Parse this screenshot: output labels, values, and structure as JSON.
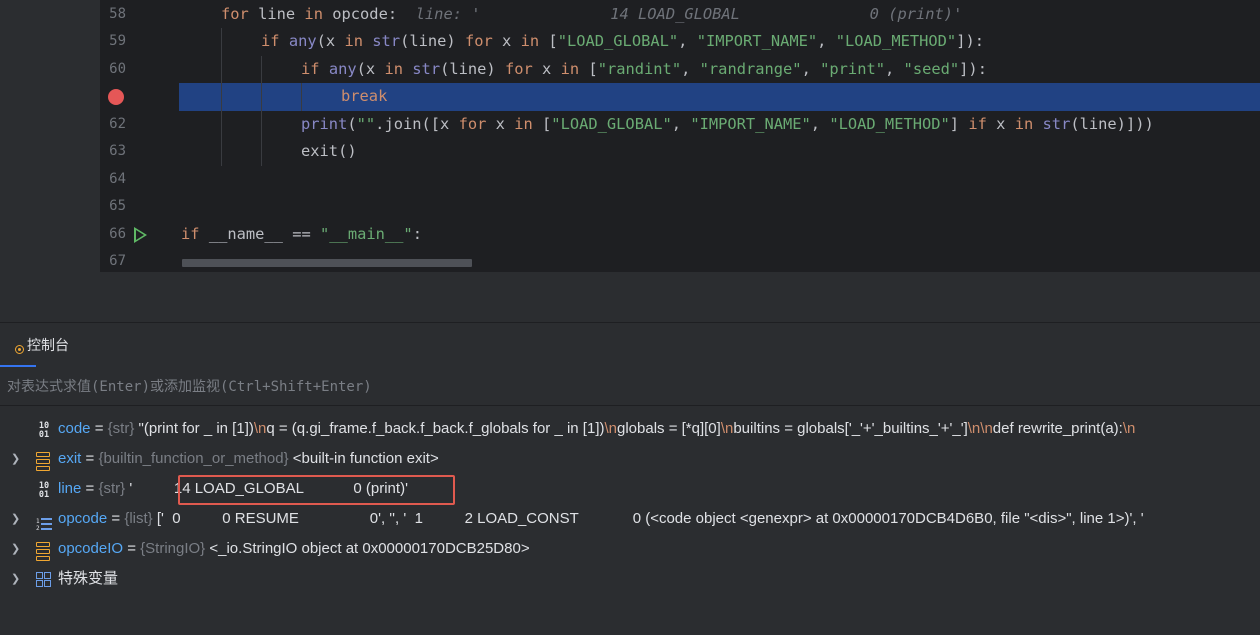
{
  "editor": {
    "lines": [
      {
        "no": "58",
        "indent": 1,
        "tokens": [
          [
            "kw",
            "for"
          ],
          [
            "p",
            " line "
          ],
          [
            "kw",
            "in"
          ],
          [
            "p",
            " opcode:"
          ]
        ],
        "hint": "line: '              14 LOAD_GLOBAL              0 (print)'"
      },
      {
        "no": "59",
        "indent": 2,
        "tokens": [
          [
            "kw",
            "if"
          ],
          [
            "p",
            " "
          ],
          [
            "bi",
            "any"
          ],
          [
            "p",
            "(x "
          ],
          [
            "kw",
            "in"
          ],
          [
            "p",
            " "
          ],
          [
            "bi",
            "str"
          ],
          [
            "p",
            "(line) "
          ],
          [
            "kw",
            "for"
          ],
          [
            "p",
            " x "
          ],
          [
            "kw",
            "in"
          ],
          [
            "p",
            " ["
          ],
          [
            "st",
            "\"LOAD_GLOBAL\""
          ],
          [
            "p",
            ", "
          ],
          [
            "st",
            "\"IMPORT_NAME\""
          ],
          [
            "p",
            ", "
          ],
          [
            "st",
            "\"LOAD_METHOD\""
          ],
          [
            "p",
            "]):"
          ]
        ]
      },
      {
        "no": "60",
        "indent": 3,
        "tokens": [
          [
            "kw",
            "if"
          ],
          [
            "p",
            " "
          ],
          [
            "bi",
            "any"
          ],
          [
            "p",
            "(x "
          ],
          [
            "kw",
            "in"
          ],
          [
            "p",
            " "
          ],
          [
            "bi",
            "str"
          ],
          [
            "p",
            "(line) "
          ],
          [
            "kw",
            "for"
          ],
          [
            "p",
            " x "
          ],
          [
            "kw",
            "in"
          ],
          [
            "p",
            " ["
          ],
          [
            "st",
            "\"randint\""
          ],
          [
            "p",
            ", "
          ],
          [
            "st",
            "\"randrange\""
          ],
          [
            "p",
            ", "
          ],
          [
            "st",
            "\"print\""
          ],
          [
            "p",
            ", "
          ],
          [
            "st",
            "\"seed\""
          ],
          [
            "p",
            "]):"
          ]
        ]
      },
      {
        "no": "",
        "indent": 4,
        "breakpoint": true,
        "highlight": true,
        "tokens": [
          [
            "kw",
            "break"
          ]
        ]
      },
      {
        "no": "62",
        "indent": 3,
        "tokens": [
          [
            "bi",
            "print"
          ],
          [
            "p",
            "("
          ],
          [
            "st",
            "\"\""
          ],
          [
            "p",
            ".join([x "
          ],
          [
            "kw",
            "for"
          ],
          [
            "p",
            " x "
          ],
          [
            "kw",
            "in"
          ],
          [
            "p",
            " ["
          ],
          [
            "st",
            "\"LOAD_GLOBAL\""
          ],
          [
            "p",
            ", "
          ],
          [
            "st",
            "\"IMPORT_NAME\""
          ],
          [
            "p",
            ", "
          ],
          [
            "st",
            "\"LOAD_METHOD\""
          ],
          [
            "p",
            "] "
          ],
          [
            "kw",
            "if"
          ],
          [
            "p",
            " x "
          ],
          [
            "kw",
            "in"
          ],
          [
            "p",
            " "
          ],
          [
            "bi",
            "str"
          ],
          [
            "p",
            "(line)]))"
          ]
        ]
      },
      {
        "no": "63",
        "indent": 3,
        "tokens": [
          [
            "p",
            "exit()"
          ]
        ]
      },
      {
        "no": "64",
        "indent": 0,
        "tokens": []
      },
      {
        "no": "65",
        "indent": 0,
        "tokens": []
      },
      {
        "no": "66",
        "indent": 0,
        "run": true,
        "tokens": [
          [
            "kw",
            "if"
          ],
          [
            "p",
            " __name__ == "
          ],
          [
            "st",
            "\"__main__\""
          ],
          [
            "p",
            ":"
          ]
        ]
      },
      {
        "no": "67",
        "indent": 0,
        "tokens": []
      }
    ]
  },
  "console": {
    "tab_label": "控制台",
    "eval_placeholder": "对表达式求值(Enter)或添加监视(Ctrl+Shift+Enter)"
  },
  "variables": [
    {
      "icon": "binary-icon",
      "expandable": false,
      "name": "code",
      "type": "{str}",
      "value_parts": [
        [
          "v",
          " \"(print for _ in [1])"
        ],
        [
          "e",
          "\\n"
        ],
        [
          "v",
          "q = (q.gi_frame.f_back.f_back.f_globals for _ in [1])"
        ],
        [
          "e",
          "\\n"
        ],
        [
          "v",
          "globals = [*q][0]"
        ],
        [
          "e",
          "\\n"
        ],
        [
          "v",
          "builtins = globals['_'+'_builtins_'+'_']"
        ],
        [
          "e",
          "\\n\\n"
        ],
        [
          "v",
          "def rewrite_print(a):"
        ],
        [
          "e",
          "\\n"
        ]
      ]
    },
    {
      "icon": "stack-icon",
      "expandable": true,
      "name": "exit",
      "type": "{builtin_function_or_method}",
      "value_parts": [
        [
          "v",
          " <built-in function exit>"
        ]
      ]
    },
    {
      "icon": "binary-icon",
      "expandable": false,
      "name": "line",
      "type": "{str}",
      "value_parts": [
        [
          "v",
          " '          14 LOAD_GLOBAL            0 (print)'"
        ]
      ]
    },
    {
      "icon": "list-icon",
      "expandable": true,
      "name": "opcode",
      "type": "{list}",
      "value_parts": [
        [
          "v",
          " ['  0          0 RESUME                 0', '', '  1          2 LOAD_CONST             0 (<code object <genexpr> at 0x00000170DCB4D6B0, file \"<dis>\", line 1>)', '"
        ]
      ]
    },
    {
      "icon": "stack-icon",
      "expandable": true,
      "name": "opcodeIO",
      "type": "{StringIO}",
      "value_parts": [
        [
          "v",
          " <_io.StringIO object at 0x00000170DCB25D80>"
        ]
      ]
    },
    {
      "icon": "grid-icon",
      "expandable": true,
      "name": "特殊变量",
      "type": "",
      "value_parts": []
    }
  ],
  "colors": {
    "highlight": "#214283",
    "breakpoint": "#e55757",
    "annotation_box": "#e05a4f",
    "accent": "#3574f0"
  }
}
